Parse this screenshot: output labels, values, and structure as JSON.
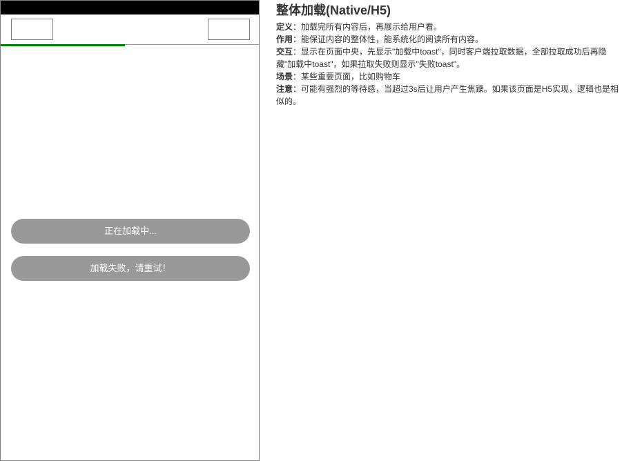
{
  "notes": {
    "title": "整体加载(Native/H5)",
    "items": [
      {
        "term": "定义",
        "sep": "：",
        "text": "加载完所有内容后，再展示给用户看。"
      },
      {
        "term": "作用",
        "sep": "：",
        "text": "能保证内容的整体性，能系统化的阅读所有内容。"
      },
      {
        "term": "交互",
        "sep": "：",
        "text": "显示在页面中央，先显示\"加载中toast\"，同时客户端拉取数据，全部拉取成功后再隐藏\"加载中toast\"，如果拉取失败则显示\"失败toast\"。"
      },
      {
        "term": "场景",
        "sep": "：",
        "text": "某些重要页面，比如购物车"
      },
      {
        "term": "注意",
        "sep": "：",
        "text": "可能有强烈的等待感，当超过3s后让用户产生焦躁。如果该页面是H5实现，逻辑也是相似的。"
      }
    ]
  },
  "phone": {
    "progress": 0.48,
    "progress_color": "#008000",
    "toast_loading": "正在加载中...",
    "toast_failed": "加载失败，请重试！"
  }
}
